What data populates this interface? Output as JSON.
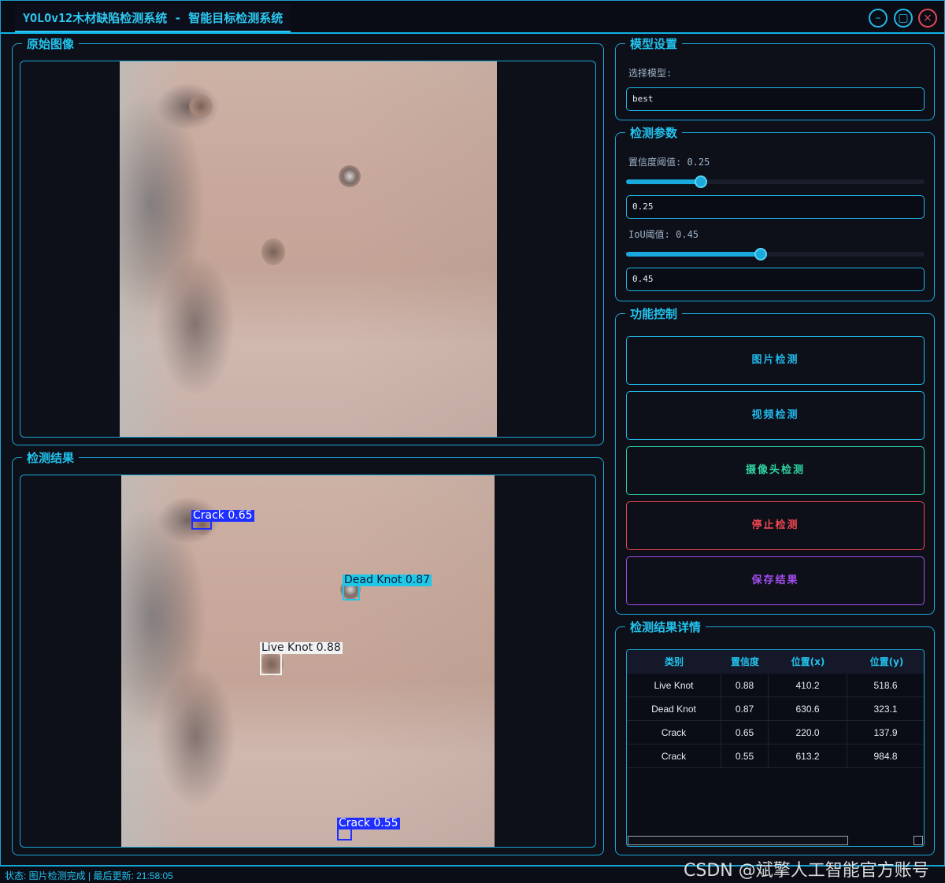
{
  "window": {
    "title": "YOLOv12木材缺陷检测系统 - 智能目标检测系统",
    "minimize_glyph": "–",
    "maximize_glyph": "▢",
    "close_glyph": "×"
  },
  "original_panel": {
    "title": "原始图像"
  },
  "result_panel": {
    "title": "检测结果",
    "detections": [
      {
        "label": "Crack 0.65",
        "color": "#1f2fff"
      },
      {
        "label": "Dead Knot 0.87",
        "color": "#1ec8e6"
      },
      {
        "label": "Live Knot 0.88",
        "color": "#f2f2f2"
      },
      {
        "label": "Crack 0.55",
        "color": "#1f2fff"
      }
    ]
  },
  "model_settings": {
    "title": "模型设置",
    "select_label": "选择模型:",
    "selected_model": "best"
  },
  "detection_params": {
    "title": "检测参数",
    "conf_label": "置信度阈值: 0.25",
    "conf_value": "0.25",
    "conf_fraction": 0.25,
    "iou_label": "IoU阈值: 0.45",
    "iou_value": "0.45",
    "iou_fraction": 0.45
  },
  "function_control": {
    "title": "功能控制",
    "buttons": [
      {
        "label": "图片检测",
        "color": "#22b9ea"
      },
      {
        "label": "视频检测",
        "color": "#22b9ea"
      },
      {
        "label": "摄像头检测",
        "color": "#2ed3a0"
      },
      {
        "label": "停止检测",
        "color": "#f0474f"
      },
      {
        "label": "保存结果",
        "color": "#a54ef0"
      }
    ]
  },
  "results_table": {
    "title": "检测结果详情",
    "headers": [
      "类别",
      "置信度",
      "位置(x)",
      "位置(y)"
    ],
    "rows": [
      [
        "Live Knot",
        "0.88",
        "410.2",
        "518.6"
      ],
      [
        "Dead Knot",
        "0.87",
        "630.6",
        "323.1"
      ],
      [
        "Crack",
        "0.65",
        "220.0",
        "137.9"
      ],
      [
        "Crack",
        "0.55",
        "613.2",
        "984.8"
      ]
    ]
  },
  "status": {
    "text": "状态: 图片检测完成 | 最后更新: 21:58:05"
  },
  "watermark": {
    "text": "CSDN @斌擎人工智能官方账号"
  }
}
